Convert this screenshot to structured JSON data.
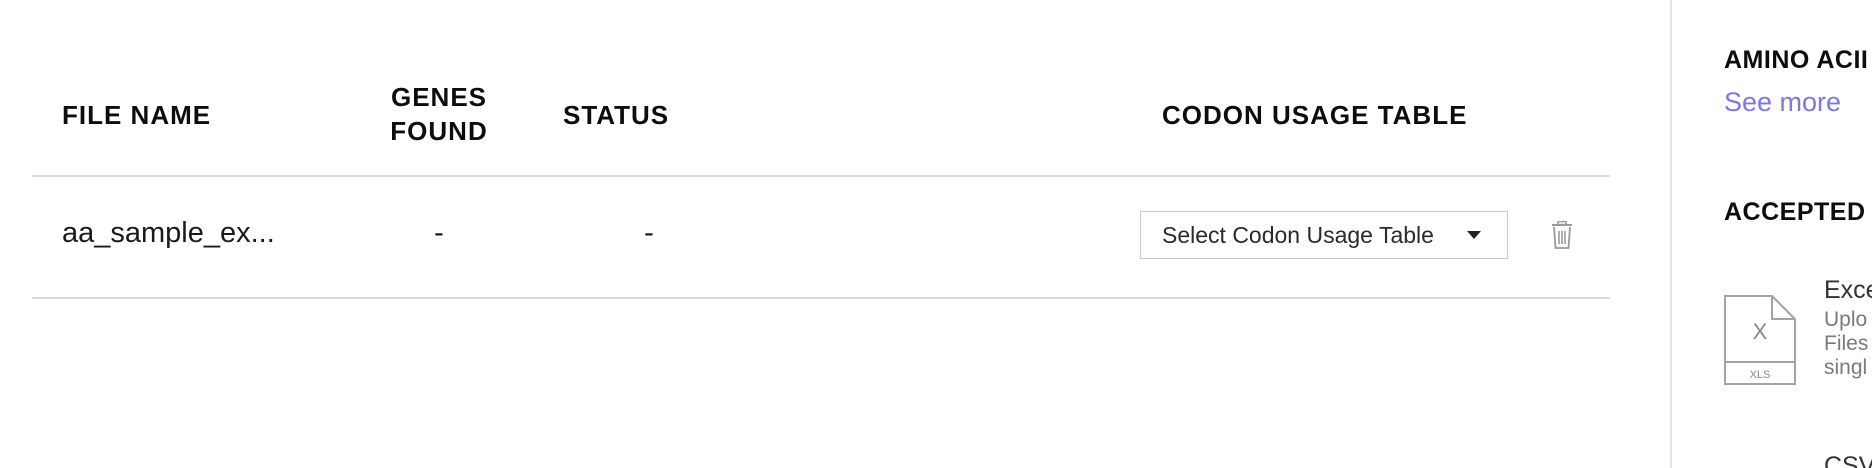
{
  "table": {
    "headers": {
      "file_name": "FILE NAME",
      "genes_found_line1": "GENES",
      "genes_found_line2": "FOUND",
      "status": "STATUS",
      "codon_usage_table": "CODON USAGE TABLE"
    },
    "rows": [
      {
        "file_name": "aa_sample_ex...",
        "genes_found": "-",
        "status": "-",
        "codon_select": {
          "placeholder": "Select Codon Usage Table"
        },
        "delete_icon": "trash-icon"
      }
    ]
  },
  "side_panel": {
    "amino_title": "AMINO ACII",
    "see_more": "See more",
    "accepted_title": "ACCEPTED",
    "excel": {
      "icon": "xls-file-icon",
      "icon_letter": "X",
      "icon_ext": "XLS",
      "title": "Exce",
      "desc_line1": "Uplo",
      "desc_line2": "Files",
      "desc_line3": "singl"
    },
    "csv": {
      "title": "CSV"
    }
  },
  "colors": {
    "link": "#7b78e4",
    "divider": "#dcdcdc",
    "text": "#111111"
  }
}
